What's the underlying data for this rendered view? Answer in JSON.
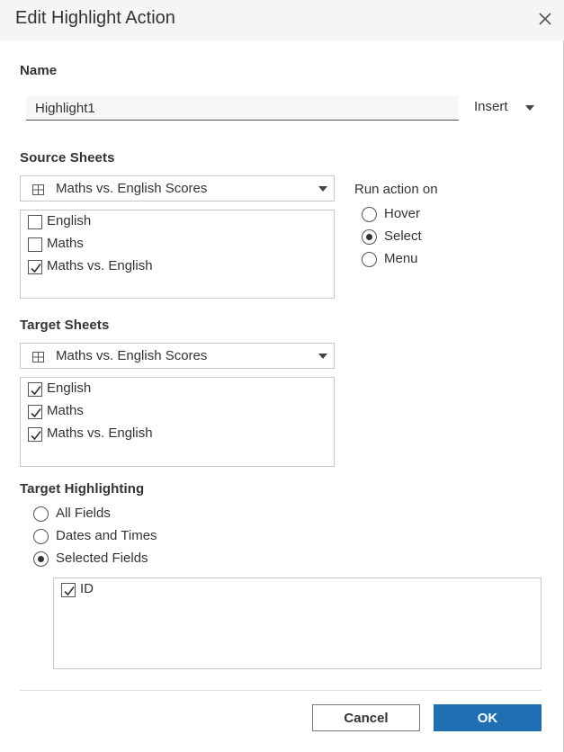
{
  "dialog": {
    "title": "Edit Highlight Action"
  },
  "name": {
    "label": "Name",
    "value": "Highlight1",
    "insert_label": "Insert"
  },
  "source": {
    "label": "Source Sheets",
    "dropdown_value": "Maths vs. English Scores",
    "sheets": [
      {
        "label": "English",
        "checked": false
      },
      {
        "label": "Maths",
        "checked": false
      },
      {
        "label": "Maths vs. English",
        "checked": true
      }
    ]
  },
  "run_action": {
    "label": "Run action on",
    "options": [
      {
        "label": "Hover",
        "selected": false
      },
      {
        "label": "Select",
        "selected": true
      },
      {
        "label": "Menu",
        "selected": false
      }
    ]
  },
  "target": {
    "label": "Target Sheets",
    "dropdown_value": "Maths vs. English Scores",
    "sheets": [
      {
        "label": "English",
        "checked": true
      },
      {
        "label": "Maths",
        "checked": true
      },
      {
        "label": "Maths vs. English",
        "checked": true
      }
    ]
  },
  "highlighting": {
    "label": "Target Highlighting",
    "options": [
      {
        "label": "All Fields",
        "selected": false
      },
      {
        "label": "Dates and Times",
        "selected": false
      },
      {
        "label": "Selected Fields",
        "selected": true
      }
    ],
    "fields": [
      {
        "label": "ID",
        "checked": true
      }
    ]
  },
  "buttons": {
    "cancel": "Cancel",
    "ok": "OK"
  },
  "colors": {
    "primary": "#1f6fb2",
    "title_bar": "#f5f5f5",
    "border": "#c8c8c8"
  }
}
